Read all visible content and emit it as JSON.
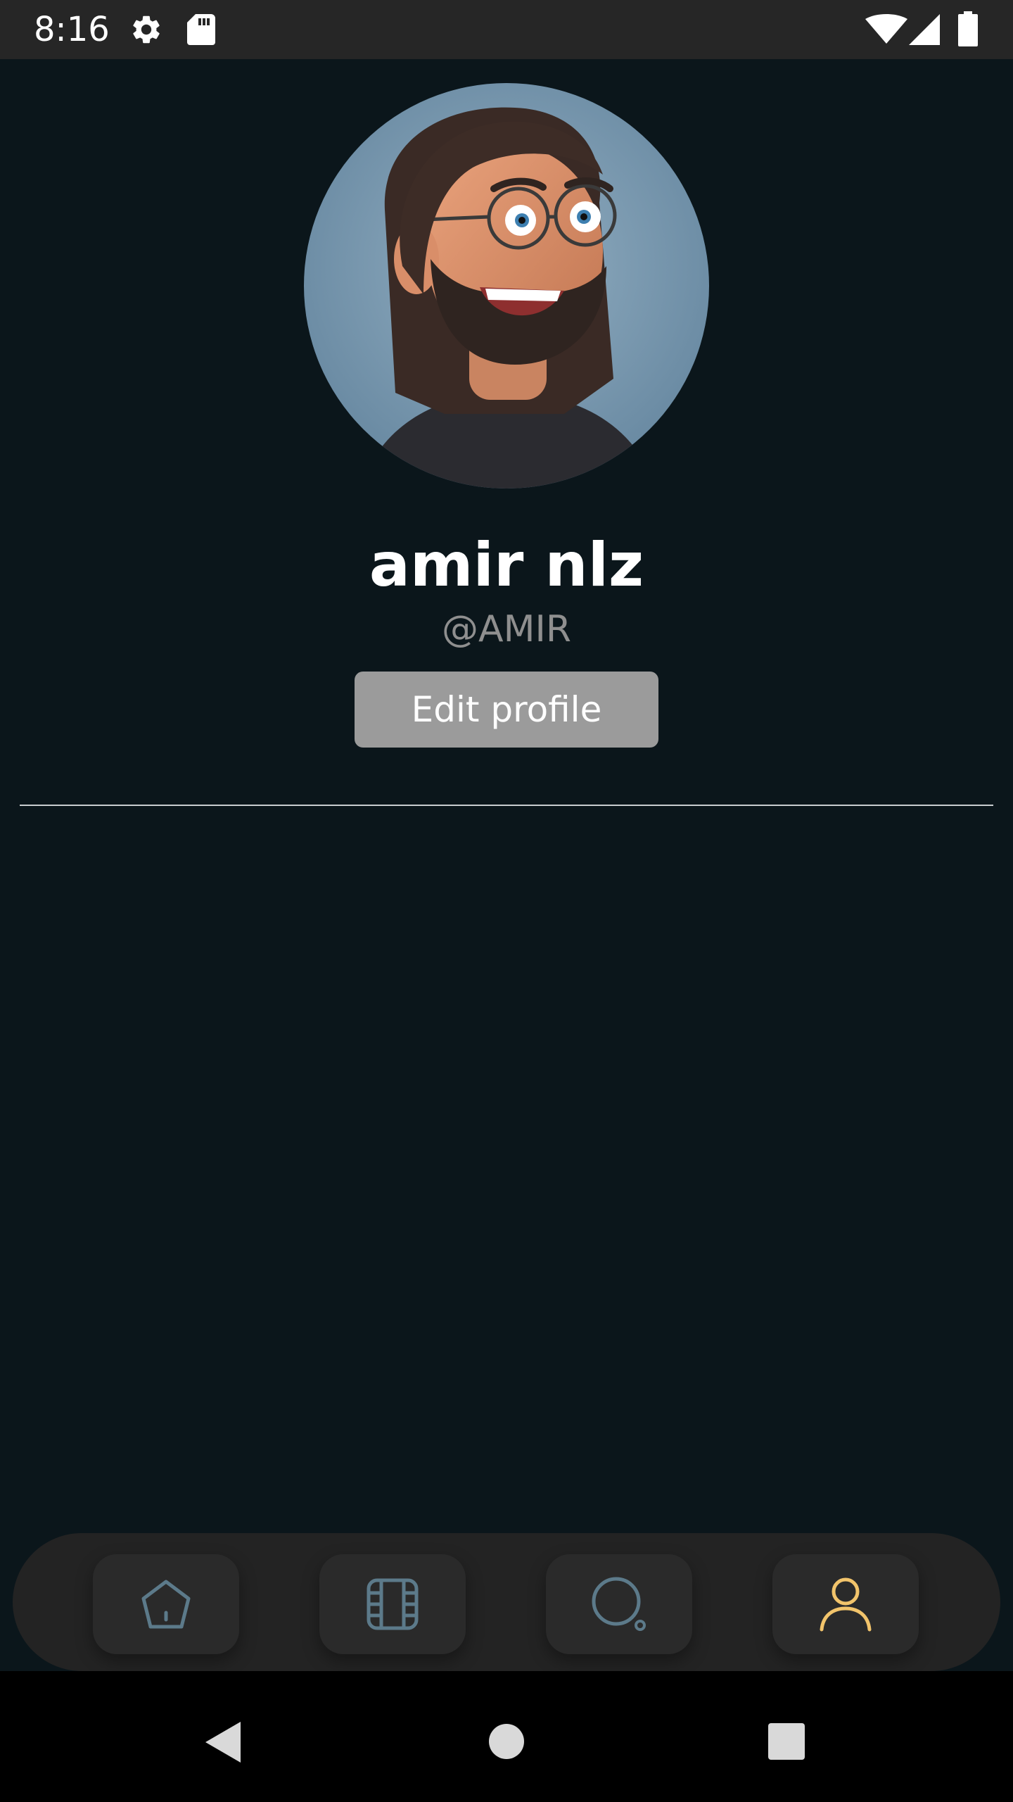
{
  "status_bar": {
    "time": "8:16",
    "icons": [
      "gear-icon",
      "sd-card-icon",
      "wifi-icon",
      "signal-icon",
      "battery-icon"
    ]
  },
  "profile": {
    "avatar": "avatar-3d-bearded-man-glasses",
    "name": "amir nlz",
    "handle": "@AMIR",
    "edit_button_label": "Edit profile"
  },
  "bottom_nav": {
    "items": [
      {
        "icon": "home-icon",
        "active": false
      },
      {
        "icon": "film-icon",
        "active": false
      },
      {
        "icon": "search-icon",
        "active": false
      },
      {
        "icon": "user-icon",
        "active": true
      }
    ],
    "inactive_color": "#5c7a8a",
    "active_color": "#f2c46b"
  },
  "system_nav": [
    "back-icon",
    "home-circle-icon",
    "recents-icon"
  ],
  "colors": {
    "background": "#0b161b",
    "status_bar": "#262626",
    "button": "#9b9b9b",
    "nav_bar": "#232323"
  }
}
